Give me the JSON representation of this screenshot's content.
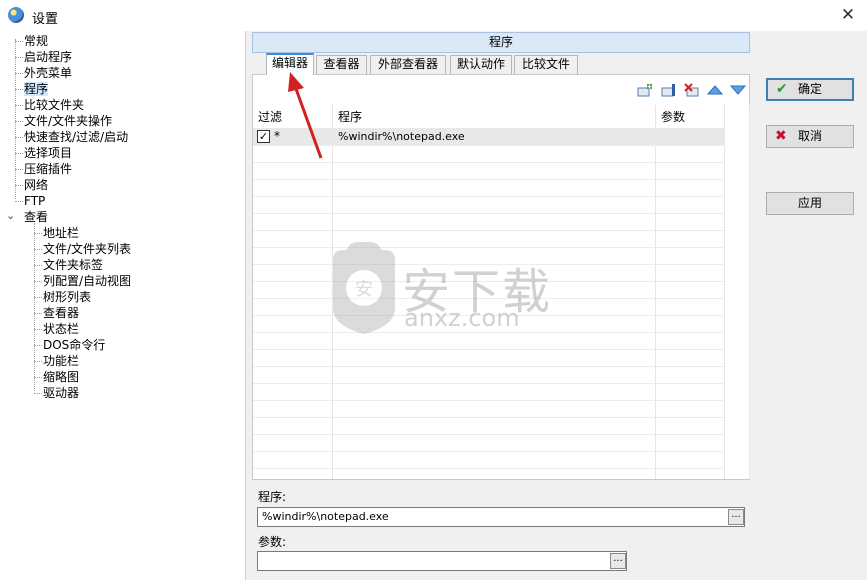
{
  "window": {
    "title": "设置",
    "close_glyph": "✕"
  },
  "tree": {
    "items": [
      {
        "label": "常规",
        "level": 1
      },
      {
        "label": "启动程序",
        "level": 1
      },
      {
        "label": "外壳菜单",
        "level": 1
      },
      {
        "label": "程序",
        "level": 1,
        "selected": true
      },
      {
        "label": "比较文件夹",
        "level": 1
      },
      {
        "label": "文件/文件夹操作",
        "level": 1
      },
      {
        "label": "快速查找/过滤/启动",
        "level": 1
      },
      {
        "label": "选择项目",
        "level": 1
      },
      {
        "label": "压缩插件",
        "level": 1
      },
      {
        "label": "网络",
        "level": 1
      },
      {
        "label": "FTP",
        "level": 1
      },
      {
        "label": "查看",
        "level": 0,
        "expanded": true
      },
      {
        "label": "地址栏",
        "level": 2
      },
      {
        "label": "文件/文件夹列表",
        "level": 2
      },
      {
        "label": "文件夹标签",
        "level": 2
      },
      {
        "label": "列配置/自动视图",
        "level": 2
      },
      {
        "label": "树形列表",
        "level": 2
      },
      {
        "label": "查看器",
        "level": 2
      },
      {
        "label": "状态栏",
        "level": 2
      },
      {
        "label": "DOS命令行",
        "level": 2
      },
      {
        "label": "功能栏",
        "level": 2
      },
      {
        "label": "缩略图",
        "level": 2
      },
      {
        "label": "驱动器",
        "level": 2
      }
    ]
  },
  "panel": {
    "header": "程序",
    "tabs": [
      "编辑器",
      "查看器",
      "外部查看器",
      "默认动作",
      "比较文件"
    ],
    "active_tab": 0,
    "toolbar_icons": [
      "add-icon",
      "edit-icon",
      "delete-icon",
      "move-up-icon",
      "move-down-icon"
    ],
    "columns": [
      "过滤",
      "程序",
      "参数"
    ],
    "rows": [
      {
        "checked": true,
        "filter": "*",
        "program": "%windir%\\notepad.exe",
        "params": ""
      }
    ],
    "program_label": "程序:",
    "program_value": "%windir%\\notepad.exe",
    "params_label": "参数:",
    "params_value": "",
    "ellipsis": "..."
  },
  "buttons": {
    "ok": "确定",
    "cancel": "取消",
    "apply": "应用"
  },
  "watermark": {
    "text": "安下载",
    "subtext": "anxz.com"
  },
  "colors": {
    "accent": "#3d8ee0",
    "selection": "#cde8ff",
    "ok_check": "#2a9a2a",
    "cancel_x": "#c8102e",
    "arrow": "#d42020"
  }
}
